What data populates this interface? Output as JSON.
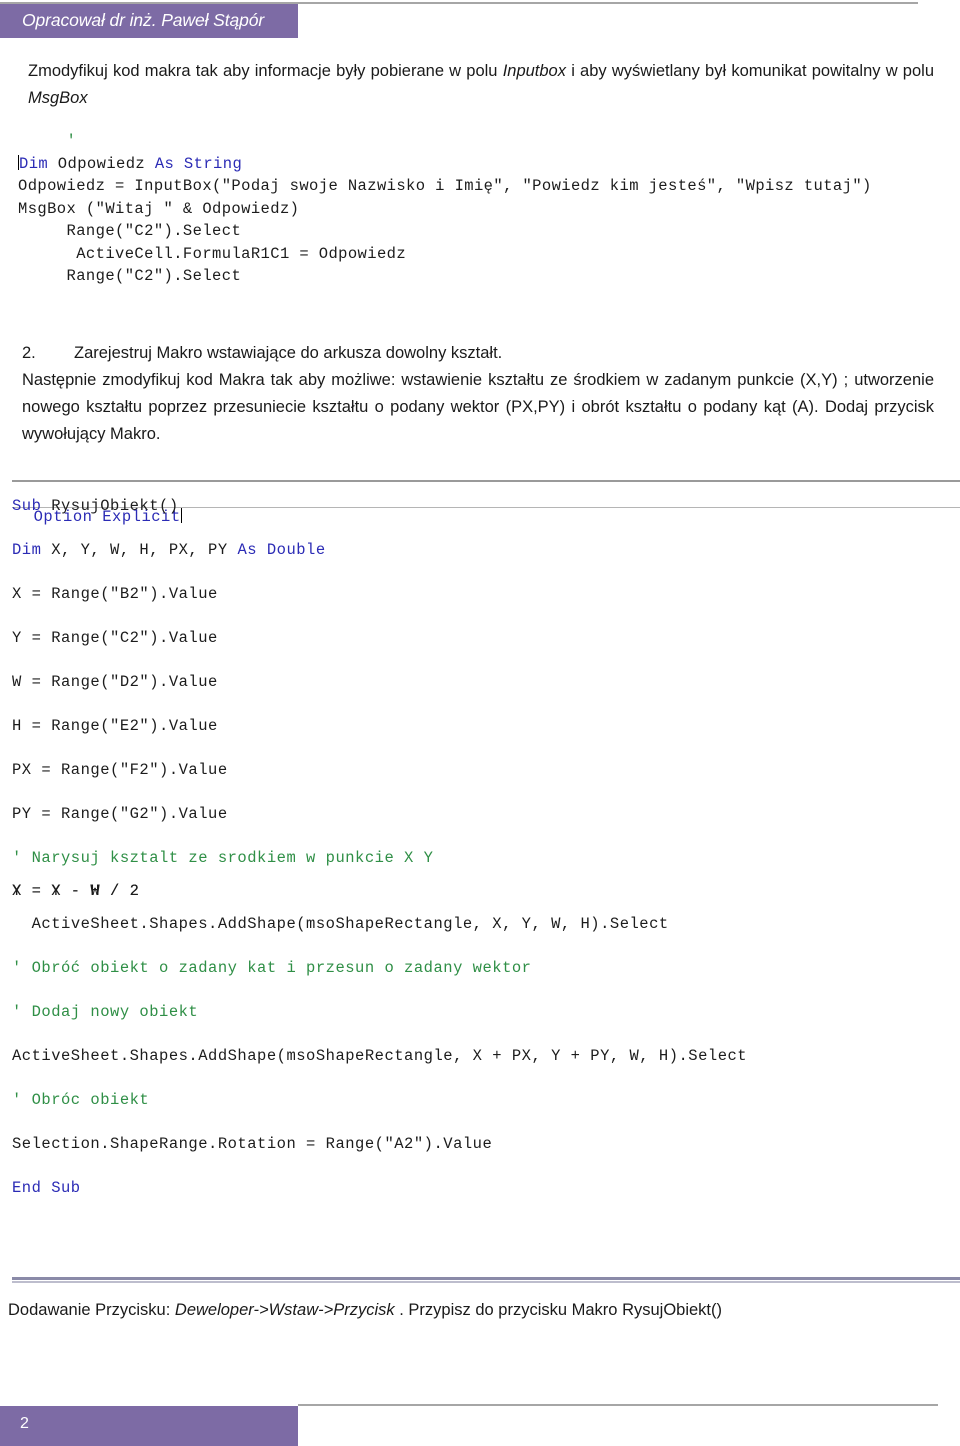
{
  "header": {
    "author_tag": "Opracował dr inż. Paweł Stąpór",
    "accent_color": "#7d6ba5",
    "rule_color": "#a6a6a6"
  },
  "intro": {
    "text_before_inputbox": "Zmodyfikuj kod makra tak aby informacje były pobierane w polu ",
    "inputbox_term": "Inputbox",
    "text_middle": " i aby wyświetlany był komunikat powitalny w polu ",
    "msgbox_term": "MsgBox"
  },
  "code_block_1": {
    "name": "vba-code-screenshot-inputbox",
    "lines": [
      {
        "indent": 5,
        "segments": [
          {
            "style": "cmt",
            "text": "'"
          }
        ]
      },
      {
        "indent": 0,
        "segments": [
          {
            "style": "kw",
            "text": "Dim"
          },
          {
            "style": "plain",
            "text": " Odpowiedz "
          },
          {
            "style": "kw",
            "text": "As String"
          }
        ],
        "caret_at_start": true
      },
      {
        "indent": 0,
        "segments": [
          {
            "style": "plain",
            "text": "Odpowiedz = InputBox(\"Podaj swoje Nazwisko i Imię\", \"Powiedz kim jesteś\", \"Wpisz tutaj\")"
          }
        ]
      },
      {
        "indent": 0,
        "segments": [
          {
            "style": "plain",
            "text": "MsgBox (\"Witaj \" & Odpowiedz)"
          }
        ]
      },
      {
        "indent": 5,
        "segments": [
          {
            "style": "plain",
            "text": "Range(\"C2\").Select"
          }
        ]
      },
      {
        "indent": 6,
        "segments": [
          {
            "style": "plain",
            "text": "ActiveCell.FormulaR1C1 = Odpowiedz"
          }
        ]
      },
      {
        "indent": 5,
        "segments": [
          {
            "style": "plain",
            "text": "Range(\"C2\").Select"
          }
        ]
      }
    ]
  },
  "task2": {
    "number": "2.",
    "heading": "Zarejestruj Makro wstawiające do arkusza dowolny kształt.",
    "body": "Następnie zmodyfikuj kod Makra tak aby możliwe: wstawienie kształtu ze środkiem w zadanym punkcie (X,Y) ; utworzenie nowego kształtu poprzez przesuniecie kształtu o podany wektor  (PX,PY) i obrót kształtu o podany kąt (A). Dodaj przycisk wywołujący Makro."
  },
  "code_block_2": {
    "name": "vba-code-screenshot-rysujobiekt",
    "option_line": {
      "kw1": "Option",
      "kw2": "Explicit"
    },
    "lines": [
      {
        "indent": 0,
        "segments": [
          {
            "style": "kw",
            "text": "Sub"
          },
          {
            "style": "plain",
            "text": " RysujObiekt()"
          }
        ]
      },
      {
        "indent": 0,
        "segments": [
          {
            "style": "plain",
            "text": ""
          }
        ]
      },
      {
        "indent": 0,
        "segments": [
          {
            "style": "kw",
            "text": "Dim"
          },
          {
            "style": "plain",
            "text": " X, Y, W, H, PX, PY "
          },
          {
            "style": "kw",
            "text": "As Double"
          }
        ]
      },
      {
        "indent": 0,
        "segments": [
          {
            "style": "plain",
            "text": "X = Range(\"B2\").Value"
          }
        ]
      },
      {
        "indent": 0,
        "segments": [
          {
            "style": "plain",
            "text": "Y = Range(\"C2\").Value"
          }
        ]
      },
      {
        "indent": 0,
        "segments": [
          {
            "style": "plain",
            "text": "W = Range(\"D2\").Value"
          }
        ]
      },
      {
        "indent": 0,
        "segments": [
          {
            "style": "plain",
            "text": "H = Range(\"E2\").Value"
          }
        ]
      },
      {
        "indent": 0,
        "segments": [
          {
            "style": "plain",
            "text": "PX = Range(\"F2\").Value"
          }
        ]
      },
      {
        "indent": 0,
        "segments": [
          {
            "style": "plain",
            "text": "PY = Range(\"G2\").Value"
          }
        ]
      },
      {
        "indent": 0,
        "segments": [
          {
            "style": "cmt",
            "text": "' Narysuj ksztalt ze srodkiem w punkcie X Y"
          }
        ]
      },
      {
        "indent": 0,
        "segments": [
          {
            "style": "plain",
            "text": "X = X - W / 2"
          }
        ],
        "tight": true
      },
      {
        "indent": 0,
        "segments": [
          {
            "style": "plain",
            "text": "Y = Y - H / 2"
          }
        ],
        "tight_prev": true
      },
      {
        "indent": 0,
        "segments": [
          {
            "style": "plain",
            "text": ""
          }
        ]
      },
      {
        "indent": 2,
        "segments": [
          {
            "style": "plain",
            "text": "ActiveSheet.Shapes.AddShape(msoShapeRectangle, X, Y, W, H).Select"
          }
        ]
      },
      {
        "indent": 0,
        "segments": [
          {
            "style": "cmt",
            "text": "' Obróć obiekt o zadany kat i przesun o zadany wektor"
          }
        ]
      },
      {
        "indent": 0,
        "segments": [
          {
            "style": "cmt",
            "text": "' Dodaj nowy obiekt"
          }
        ]
      },
      {
        "indent": 0,
        "segments": [
          {
            "style": "plain",
            "text": "ActiveSheet.Shapes.AddShape(msoShapeRectangle, X + PX, Y + PY, W, H).Select"
          }
        ]
      },
      {
        "indent": 0,
        "segments": [
          {
            "style": "cmt",
            "text": "' Obróc obiekt"
          }
        ]
      },
      {
        "indent": 0,
        "segments": [
          {
            "style": "plain",
            "text": "Selection.ShapeRange.Rotation = Range(\"A2\").Value"
          }
        ]
      },
      {
        "indent": 0,
        "segments": [
          {
            "style": "kw",
            "text": "End Sub"
          }
        ]
      }
    ]
  },
  "footer_note": {
    "prefix": "Dodawanie Przycisku: ",
    "path": "Deweloper->Wstaw->Przycisk",
    "suffix": " . Przypisz do przycisku Makro RysujObiekt()"
  },
  "footer": {
    "page_number": "2",
    "accent_color": "#7d6ba5"
  }
}
